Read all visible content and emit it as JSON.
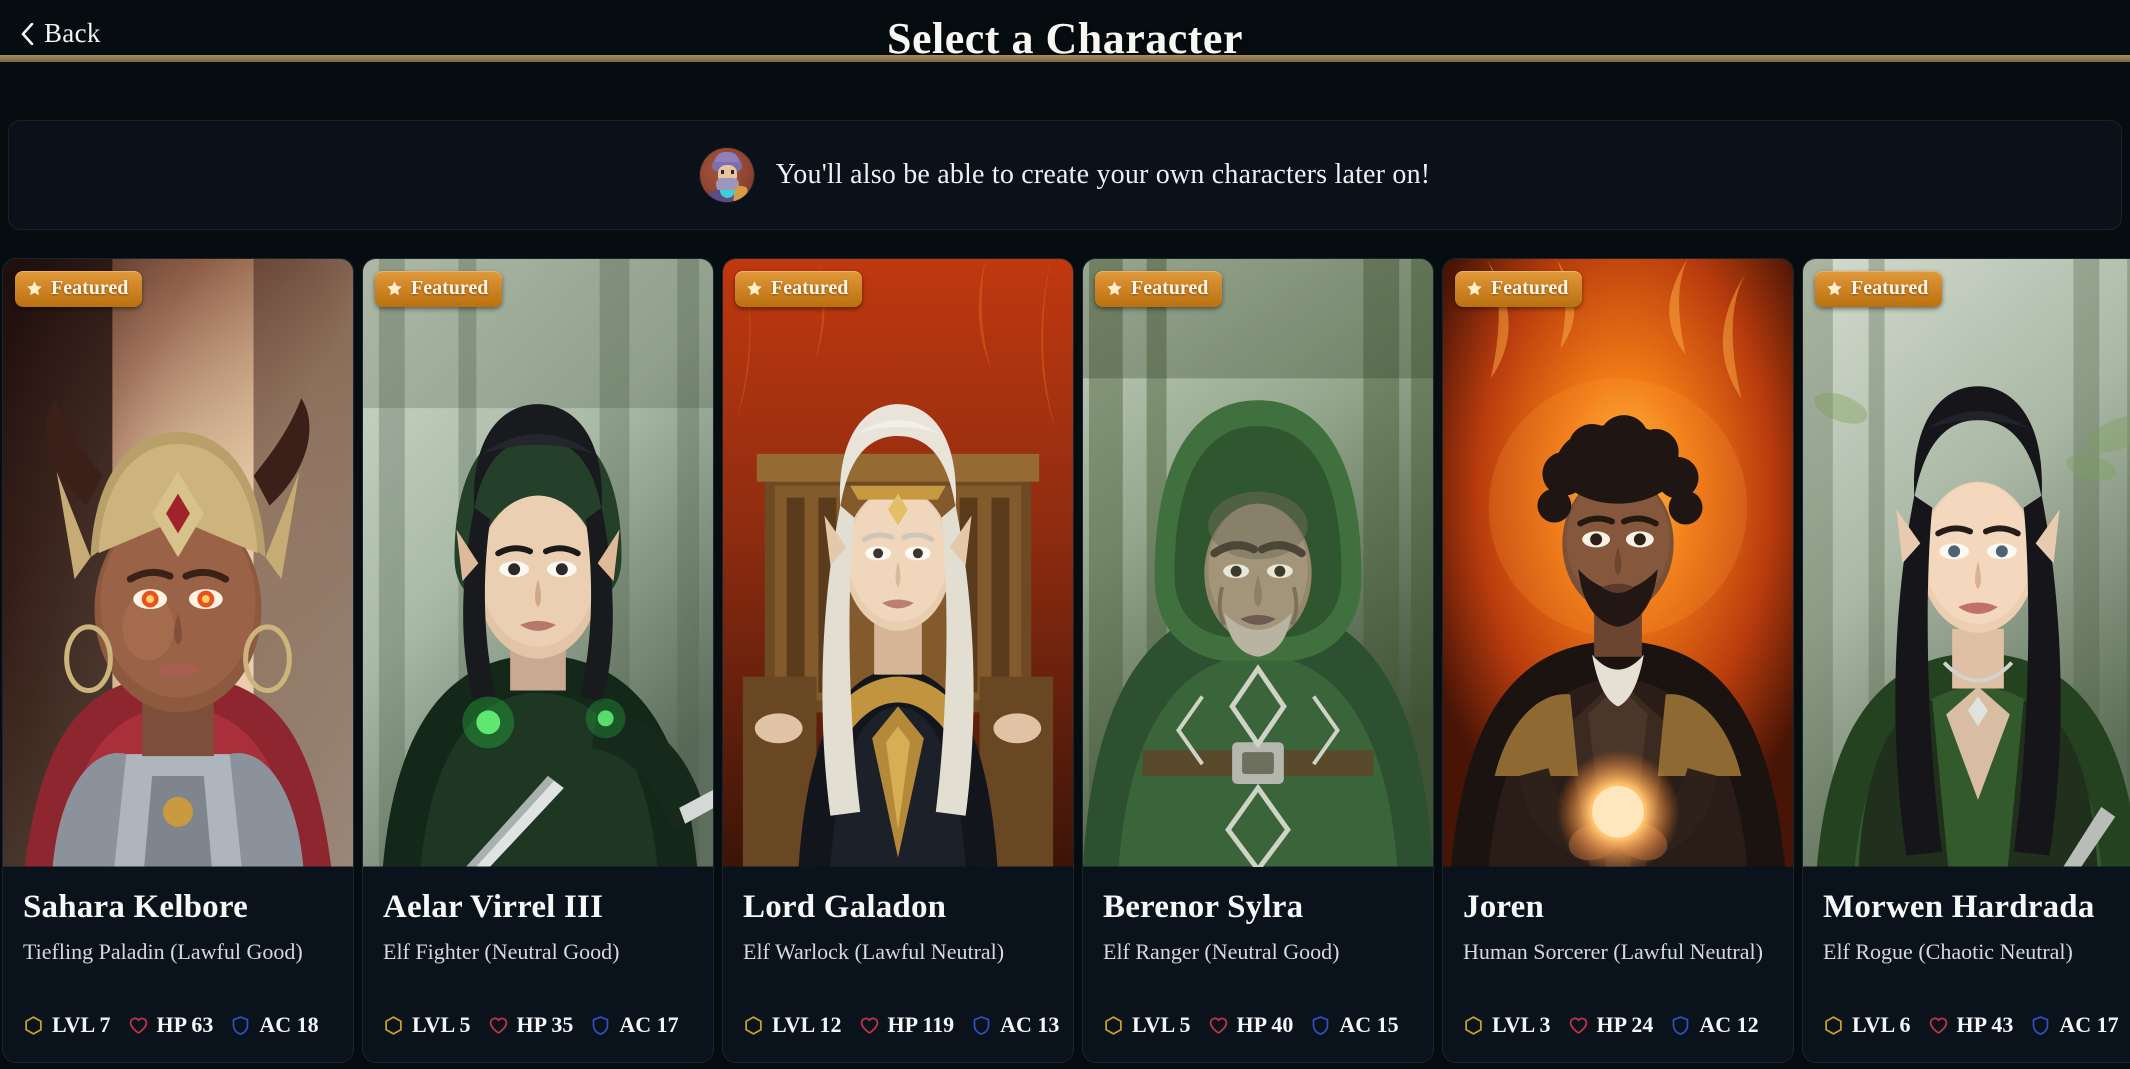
{
  "header": {
    "back_label": "Back",
    "back_icon": "chevron-left-icon",
    "title": "Select a Character",
    "rule_color": "#8e7750"
  },
  "notice": {
    "avatar_icon": "wizard-avatar",
    "text": "You'll also be able to create your own characters later on!"
  },
  "badge": {
    "label": "Featured",
    "icon": "star-icon",
    "color": "#cf8426"
  },
  "stat_icons": {
    "level": "hexagon-icon",
    "hp": "heart-icon",
    "ac": "shield-icon"
  },
  "stat_colors": {
    "level": "#c9a227",
    "hp": "#c0344a",
    "ac": "#2f4fc4"
  },
  "characters": [
    {
      "name": "Sahara Kelbore",
      "meta": "Tiefling Paladin (Lawful Good)",
      "featured": "Featured",
      "level": "LVL 7",
      "hp": "HP 63",
      "ac": "AC 18"
    },
    {
      "name": "Aelar Virrel III",
      "meta": "Elf Fighter (Neutral Good)",
      "featured": "Featured",
      "level": "LVL 5",
      "hp": "HP 35",
      "ac": "AC 17"
    },
    {
      "name": "Lord Galadon",
      "meta": "Elf Warlock (Lawful Neutral)",
      "featured": "Featured",
      "level": "LVL 12",
      "hp": "HP 119",
      "ac": "AC 13"
    },
    {
      "name": "Berenor Sylra",
      "meta": "Elf Ranger (Neutral Good)",
      "featured": "Featured",
      "level": "LVL 5",
      "hp": "HP 40",
      "ac": "AC 15"
    },
    {
      "name": "Joren",
      "meta": "Human Sorcerer (Lawful Neutral)",
      "featured": "Featured",
      "level": "LVL 3",
      "hp": "HP 24",
      "ac": "AC 12"
    },
    {
      "name": "Morwen Hardrada",
      "meta": "Elf Rogue (Chaotic Neutral)",
      "featured": "Featured",
      "level": "LVL 6",
      "hp": "HP 43",
      "ac": "AC 17"
    }
  ]
}
